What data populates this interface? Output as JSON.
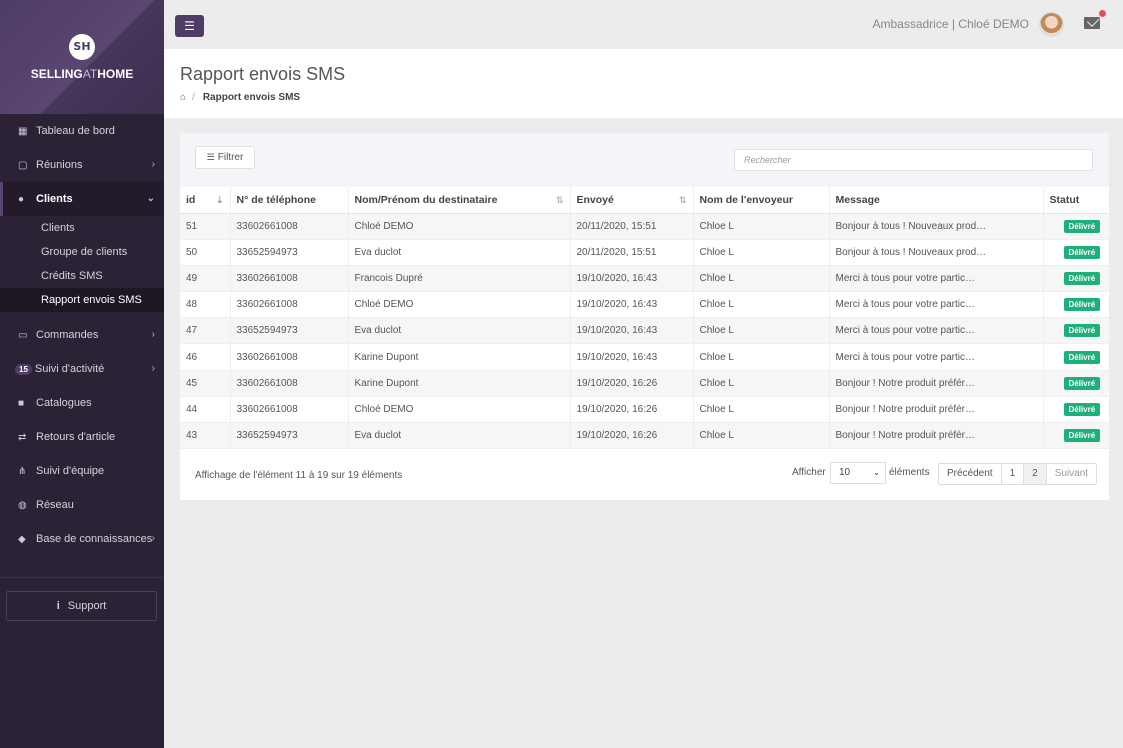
{
  "brand": {
    "logo_mark": "SH",
    "name_part1": "SELLING",
    "name_part2": "AT",
    "name_part3": "HOME"
  },
  "sidebar": {
    "items": [
      {
        "label": "Tableau de bord",
        "icon": "grid-icon"
      },
      {
        "label": "Réunions",
        "icon": "calendar-icon"
      },
      {
        "label": "Clients",
        "icon": "users-icon"
      },
      {
        "label": "Commandes",
        "icon": "credit-card-icon"
      },
      {
        "label": "Suivi d'activité",
        "icon": "activity-icon",
        "badge": "15"
      },
      {
        "label": "Catalogues",
        "icon": "book-icon"
      },
      {
        "label": "Retours d'article",
        "icon": "exchange-icon"
      },
      {
        "label": "Suivi d'équipe",
        "icon": "sitemap-icon"
      },
      {
        "label": "Réseau",
        "icon": "globe-icon"
      },
      {
        "label": "Base de connaissances",
        "icon": "graduation-cap-icon"
      }
    ],
    "clients_sub": [
      "Clients",
      "Groupe de clients",
      "Crédits SMS",
      "Rapport envois SMS"
    ],
    "support_label": "Support"
  },
  "topbar": {
    "user_label": "Ambassadrice | Chloé DEMO"
  },
  "header": {
    "title": "Rapport envois SMS",
    "breadcrumb_current": "Rapport envois SMS"
  },
  "toolbar": {
    "filter_label": "Filtrer",
    "search_placeholder": "Rechercher"
  },
  "table": {
    "columns": [
      "id",
      "N° de téléphone",
      "Nom/Prénom du destinataire",
      "Envoyé",
      "Nom de l'envoyeur",
      "Message",
      "Statut"
    ],
    "rows": [
      [
        "51",
        "33602661008",
        "Chloé DEMO",
        "20/11/2020, 15:51",
        "Chloe L",
        "Bonjour à tous ! Nouveaux prod…",
        "Délivré"
      ],
      [
        "50",
        "33652594973",
        "Eva duclot",
        "20/11/2020, 15:51",
        "Chloe L",
        "Bonjour à tous ! Nouveaux prod…",
        "Délivré"
      ],
      [
        "49",
        "33602661008",
        "Francois Dupré",
        "19/10/2020, 16:43",
        "Chloe L",
        "Merci à tous pour votre partic…",
        "Délivré"
      ],
      [
        "48",
        "33602661008",
        "Chloé DEMO",
        "19/10/2020, 16:43",
        "Chloe L",
        "Merci à tous pour votre partic…",
        "Délivré"
      ],
      [
        "47",
        "33652594973",
        "Eva duclot",
        "19/10/2020, 16:43",
        "Chloe L",
        "Merci à tous pour votre partic…",
        "Délivré"
      ],
      [
        "46",
        "33602661008",
        "Karine Dupont",
        "19/10/2020, 16:43",
        "Chloe L",
        "Merci à tous pour votre partic…",
        "Délivré"
      ],
      [
        "45",
        "33602661008",
        "Karine Dupont",
        "19/10/2020, 16:26",
        "Chloe L",
        "Bonjour ! Notre produit préfér…",
        "Délivré"
      ],
      [
        "44",
        "33602661008",
        "Chloé DEMO",
        "19/10/2020, 16:26",
        "Chloe L",
        "Bonjour ! Notre produit préfér…",
        "Délivré"
      ],
      [
        "43",
        "33652594973",
        "Eva duclot",
        "19/10/2020, 16:26",
        "Chloe L",
        "Bonjour ! Notre produit préfér…",
        "Délivré"
      ]
    ]
  },
  "footer": {
    "info": "Affichage de l'élément 11 à 19 sur 19 éléments",
    "show_label": "Afficher",
    "page_size": "10",
    "elements_label": "éléments",
    "pager": {
      "prev": "Précédent",
      "pages": [
        "1",
        "2"
      ],
      "next": "Suivant"
    }
  },
  "colors": {
    "sidebar_bg": "#2b2235",
    "brand_purple": "#4d3c63",
    "status_green": "#1fb07a",
    "notification_red": "#e74c5b"
  }
}
